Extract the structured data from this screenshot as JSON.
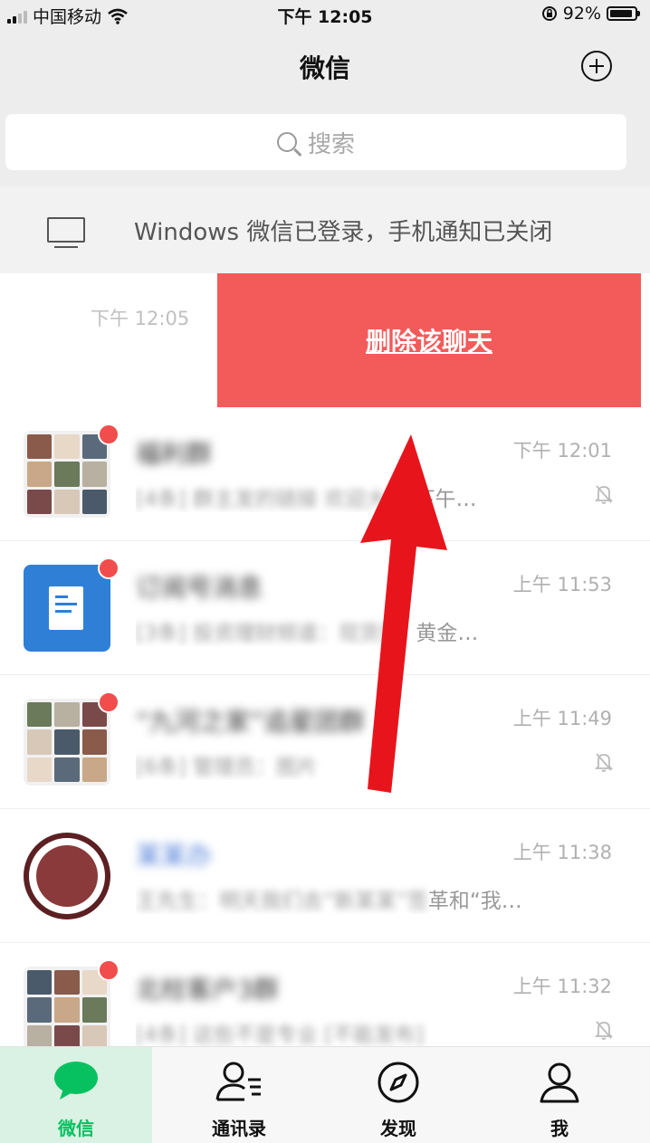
{
  "status_bar": {
    "carrier": "中国移动",
    "time": "下午 12:05",
    "battery": "92%",
    "battery_level": 0.92
  },
  "nav": {
    "title": "微信"
  },
  "search": {
    "placeholder": "搜索"
  },
  "login_banner": {
    "text": "Windows 微信已登录，手机通知已关闭"
  },
  "swiped_chat": {
    "time": "下午 12:05",
    "delete_label": "删除该聊天"
  },
  "chats": [
    {
      "name": "福利群",
      "preview_blur": "[4条] 群主发的链接 欢迎大家",
      "preview_visible": " 下午…",
      "time": "下午 12:01",
      "muted": true,
      "unread": true,
      "avatar": "grid"
    },
    {
      "name": "订阅号消息",
      "preview_blur": "[3条] 投资理财频道：现货黄",
      "preview_visible": "!  黄金…",
      "time": "上午 11:53",
      "muted": false,
      "unread": true,
      "avatar": "doc"
    },
    {
      "name": "“九河之家”追星团群",
      "preview_blur": "[6条] 管理员：图片",
      "preview_visible": "",
      "time": "上午 11:49",
      "muted": true,
      "unread": true,
      "avatar": "grid"
    },
    {
      "name": "某某办",
      "preview_blur": "王先生：明天我们去“新某某”签",
      "preview_visible": "革和“我…",
      "time": "上午 11:38",
      "muted": false,
      "unread": false,
      "avatar": "seal"
    },
    {
      "name": "北柱客户3群",
      "preview_blur": "[4条] 这些不是专业 [不能发布]",
      "preview_visible": "",
      "time": "上午 11:32",
      "muted": true,
      "unread": true,
      "avatar": "grid"
    }
  ],
  "tabs": [
    {
      "label": "微信",
      "icon": "chat-bubble-icon",
      "active": true
    },
    {
      "label": "通讯录",
      "icon": "contacts-icon",
      "active": false
    },
    {
      "label": "发现",
      "icon": "compass-icon",
      "active": false
    },
    {
      "label": "我",
      "icon": "person-icon",
      "active": false
    }
  ],
  "colors": {
    "delete_red": "#f35a5a",
    "wechat_green": "#07c160",
    "annotation_arrow": "#e8141c"
  }
}
